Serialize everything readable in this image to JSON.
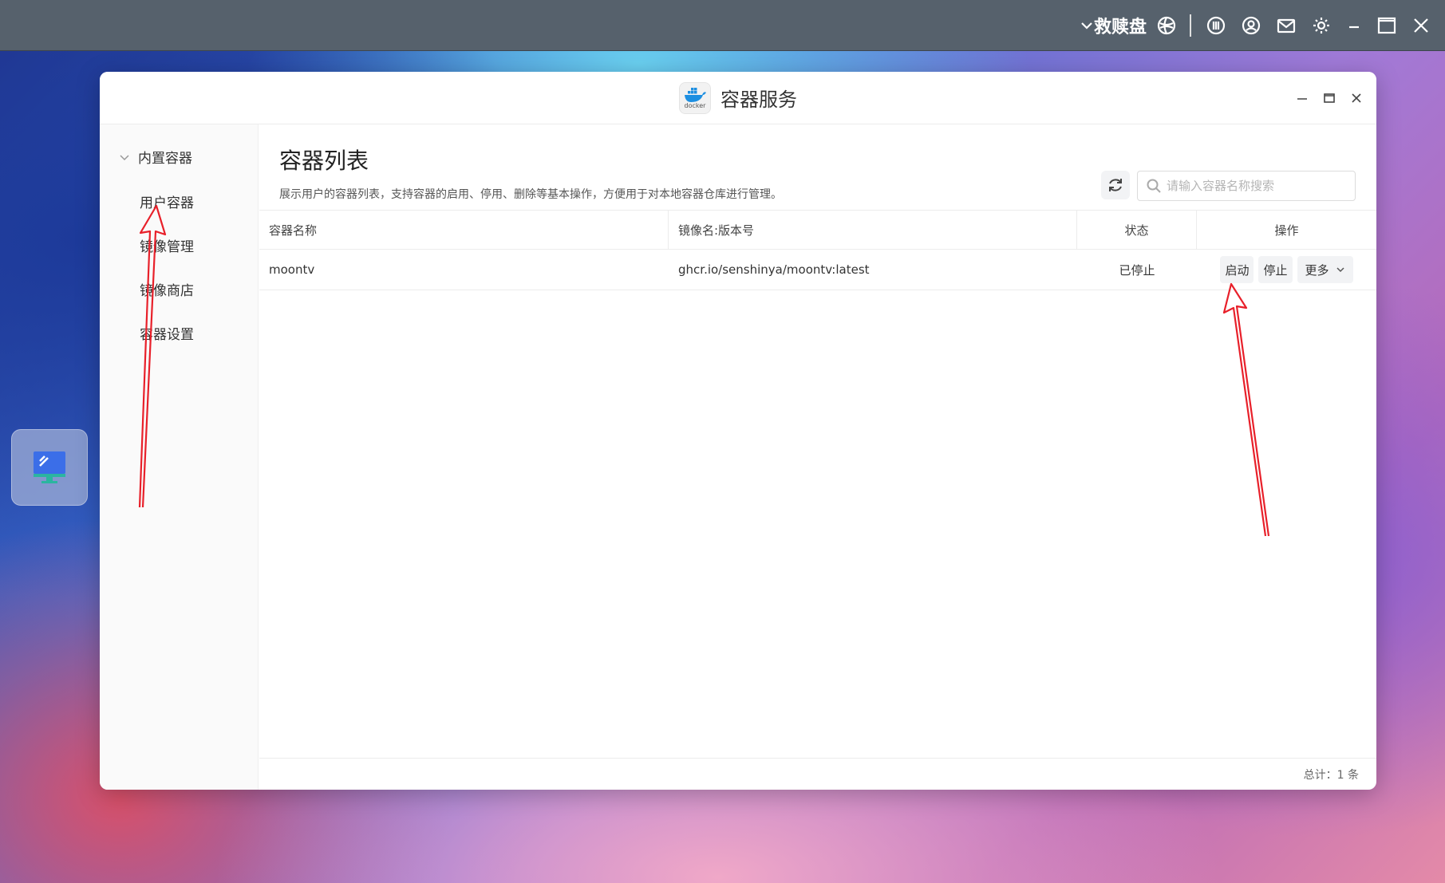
{
  "os_bar": {
    "title": "救赎盘",
    "icons": [
      "chevron-down-icon",
      "network-icon",
      "app-center-icon",
      "user-icon",
      "mail-icon",
      "gear-icon",
      "minimize-icon",
      "maximize-icon",
      "close-icon"
    ]
  },
  "window": {
    "app_logo_label": "docker",
    "title": "容器服务"
  },
  "sidebar": {
    "group_label": "内置容器",
    "items": [
      {
        "label": "用户容器"
      },
      {
        "label": "镜像管理"
      },
      {
        "label": "镜像商店"
      },
      {
        "label": "容器设置"
      }
    ]
  },
  "main": {
    "title": "容器列表",
    "description": "展示用户的容器列表，支持容器的启用、停用、删除等基本操作，方便用于对本地容器仓库进行管理。",
    "search_placeholder": "请输入容器名称搜索"
  },
  "table": {
    "headers": [
      "容器名称",
      "镜像名:版本号",
      "状态",
      "操作"
    ],
    "rows": [
      {
        "name": "moontv",
        "image": "ghcr.io/senshinya/moontv:latest",
        "status": "已停止"
      }
    ],
    "actions": {
      "start": "启动",
      "stop": "停止",
      "more": "更多"
    }
  },
  "footer": {
    "total": "总计：1 条"
  },
  "colors": {
    "os_bar": "#56616c",
    "annotation": "#e8202a"
  }
}
